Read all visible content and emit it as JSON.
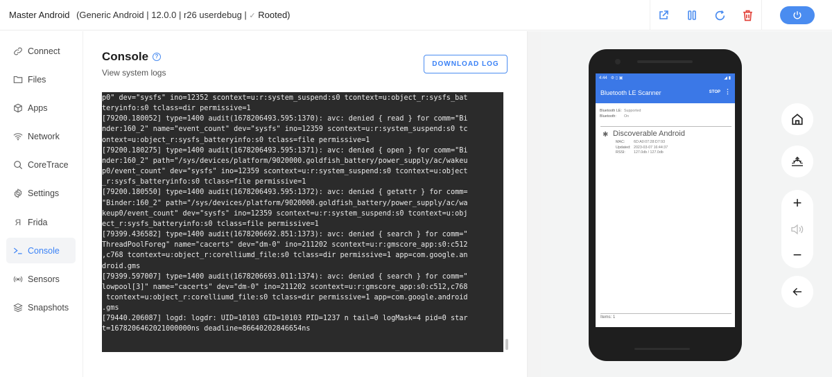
{
  "header": {
    "device_name": "Master Android",
    "device_details": "(Generic Android | 12.0.0 | r26 userdebug |",
    "rooted_check": "✓",
    "rooted_label": "Rooted)",
    "toolbar": {
      "open_external": "external-link-icon",
      "pause": "pause-icon",
      "restart": "refresh-icon",
      "delete": "trash-icon",
      "power": "power-icon"
    },
    "colors": {
      "accent": "#4a8cf0",
      "danger": "#e2453c"
    }
  },
  "sidebar": {
    "items": [
      {
        "label": "Connect",
        "icon": "link-icon",
        "active": false
      },
      {
        "label": "Files",
        "icon": "folder-icon",
        "active": false
      },
      {
        "label": "Apps",
        "icon": "cube-icon",
        "active": false
      },
      {
        "label": "Network",
        "icon": "wifi-icon",
        "active": false
      },
      {
        "label": "CoreTrace",
        "icon": "search-icon",
        "active": false
      },
      {
        "label": "Settings",
        "icon": "gear-icon",
        "active": false
      },
      {
        "label": "Frida",
        "icon": "frida-icon",
        "glyph": "Я",
        "active": false
      },
      {
        "label": "Console",
        "icon": "terminal-icon",
        "active": true
      },
      {
        "label": "Sensors",
        "icon": "sensor-icon",
        "active": false
      },
      {
        "label": "Snapshots",
        "icon": "layers-icon",
        "active": false
      }
    ]
  },
  "main": {
    "title": "Console",
    "help": "?",
    "subtitle": "View system logs",
    "download_label": "DOWNLOAD LOG",
    "log_lines": [
      "p0\" dev=\"sysfs\" ino=12352 scontext=u:r:system_suspend:s0 tcontext=u:object_r:sysfs_bat",
      "teryinfo:s0 tclass=dir permissive=1",
      "[79200.180052] type=1400 audit(1678206493.595:1370): avc: denied { read } for comm=\"Bi",
      "nder:160_2\" name=\"event_count\" dev=\"sysfs\" ino=12359 scontext=u:r:system_suspend:s0 tc",
      "ontext=u:object_r:sysfs_batteryinfo:s0 tclass=file permissive=1",
      "[79200.180275] type=1400 audit(1678206493.595:1371): avc: denied { open } for comm=\"Bi",
      "nder:160_2\" path=\"/sys/devices/platform/9020000.goldfish_battery/power_supply/ac/wakeu",
      "p0/event_count\" dev=\"sysfs\" ino=12359 scontext=u:r:system_suspend:s0 tcontext=u:object",
      "_r:sysfs_batteryinfo:s0 tclass=file permissive=1",
      "[79200.180550] type=1400 audit(1678206493.595:1372): avc: denied { getattr } for comm=",
      "\"Binder:160_2\" path=\"/sys/devices/platform/9020000.goldfish_battery/power_supply/ac/wa",
      "keup0/event_count\" dev=\"sysfs\" ino=12359 scontext=u:r:system_suspend:s0 tcontext=u:obj",
      "ect_r:sysfs_batteryinfo:s0 tclass=file permissive=1",
      "[79399.436582] type=1400 audit(1678206692.851:1373): avc: denied { search } for comm=\"",
      "ThreadPoolForeg\" name=\"cacerts\" dev=\"dm-0\" ino=211202 scontext=u:r:gmscore_app:s0:c512",
      ",c768 tcontext=u:object_r:corelliumd_file:s0 tclass=dir permissive=1 app=com.google.an",
      "droid.gms",
      "[79399.597007] type=1400 audit(1678206693.011:1374): avc: denied { search } for comm=\"",
      "lowpool[3]\" name=\"cacerts\" dev=\"dm-0\" ino=211202 scontext=u:r:gmscore_app:s0:c512,c768",
      " tcontext=u:object_r:corelliumd_file:s0 tclass=dir permissive=1 app=com.google.android",
      ".gms",
      "[79440.206087] logd: logdr: UID=10103 GID=10103 PID=1237 n tail=0 logMask=4 pid=0 star",
      "t=1678206462021000000ns deadline=86640202846654ns"
    ]
  },
  "device": {
    "status_time": "4:44",
    "app_title": "Bluetooth LE Scanner",
    "stop_label": "STOP",
    "more": "⋮",
    "bt_le_label": "Bluetooth LE:",
    "bt_le_value": "Supported",
    "bt_label": "Bluetooth:",
    "bt_value": "On",
    "device_name": "Discoverable Android",
    "mac_label": "MAC:",
    "mac_value": "6D:A0:07:28:D7:93",
    "updated_label": "Updated:",
    "updated_value": "2023-03-07 16:44:37",
    "rssi_label": "RSSI:",
    "rssi_value": "127.0db / 127.0db",
    "items_count": "Items: 1",
    "app_bar_color": "#3b78e7"
  },
  "controls": {
    "home": "home-icon",
    "wake": "sunrise-icon",
    "volume_up": "+",
    "volume": "volume-icon",
    "volume_down": "−",
    "back": "back-arrow-icon"
  }
}
